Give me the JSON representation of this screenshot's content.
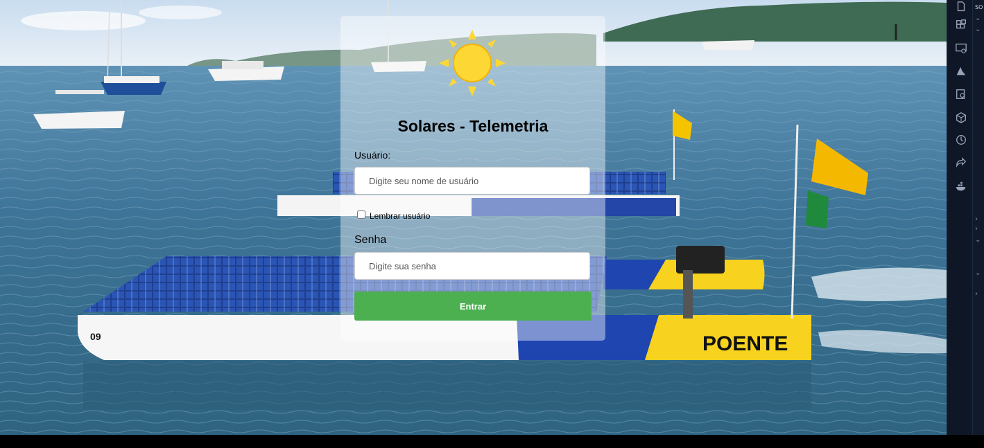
{
  "login": {
    "title": "Solares - Telemetria",
    "username_label": "Usuário:",
    "username_placeholder": "Digite seu nome de usuário",
    "remember_label": "Lembrar usuário",
    "password_label": "Senha",
    "password_placeholder": "Digite sua senha",
    "submit_label": "Entrar"
  },
  "boat": {
    "hull_text": "POENTE",
    "number": "09"
  },
  "sidebar": {
    "header_label": "SO",
    "icons": [
      "files-icon",
      "extensions-icon",
      "remote-explorer-icon",
      "azure-icon",
      "settings-sync-icon",
      "packages-icon",
      "timeline-icon",
      "deploy-icon",
      "docker-icon"
    ]
  },
  "colors": {
    "submit_button": "#4caf50",
    "sun": "#fdd835",
    "sidebar_bg": "#0f1626"
  }
}
